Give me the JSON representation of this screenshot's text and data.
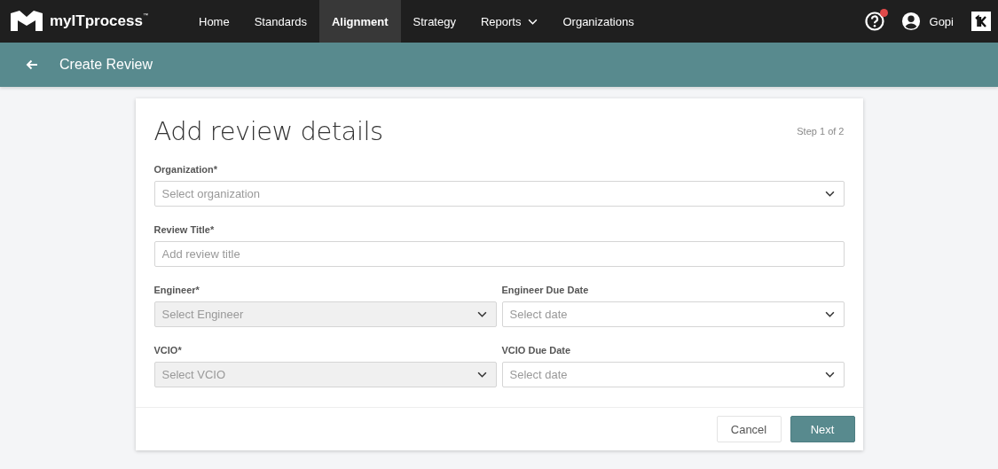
{
  "logo": {
    "text": "myITprocess",
    "mark": "™"
  },
  "nav": [
    {
      "label": "Home",
      "selected": false,
      "has_menu": false
    },
    {
      "label": "Standards",
      "selected": false,
      "has_menu": false
    },
    {
      "label": "Alignment",
      "selected": true,
      "has_menu": false
    },
    {
      "label": "Strategy",
      "selected": false,
      "has_menu": false
    },
    {
      "label": "Reports",
      "selected": false,
      "has_menu": true
    },
    {
      "label": "Organizations",
      "selected": false,
      "has_menu": false
    }
  ],
  "help": {
    "notification": true
  },
  "user": {
    "name": "Gopi"
  },
  "page_title": "Create Review",
  "form": {
    "title": "Add review details",
    "step": "Step 1 of 2",
    "rows": [
      [
        {
          "label": "Organization*",
          "kind": "select",
          "placeholder": "Select organization",
          "disabled": false
        }
      ],
      [
        {
          "label": "Review Title*",
          "kind": "text",
          "placeholder": "Add review title",
          "disabled": false
        }
      ],
      [
        {
          "label": "Engineer*",
          "kind": "select",
          "placeholder": "Select Engineer",
          "disabled": true
        },
        {
          "label": "Engineer Due Date",
          "kind": "select",
          "placeholder": "Select date",
          "disabled": false
        }
      ],
      [
        {
          "label": "VCIO*",
          "kind": "select",
          "placeholder": "Select VCIO",
          "disabled": true
        },
        {
          "label": "VCIO Due Date",
          "kind": "select",
          "placeholder": "Select date",
          "disabled": false
        }
      ]
    ],
    "buttons": [
      {
        "label": "Cancel",
        "kind": "secondary"
      },
      {
        "label": "Next",
        "kind": "primary"
      }
    ]
  }
}
